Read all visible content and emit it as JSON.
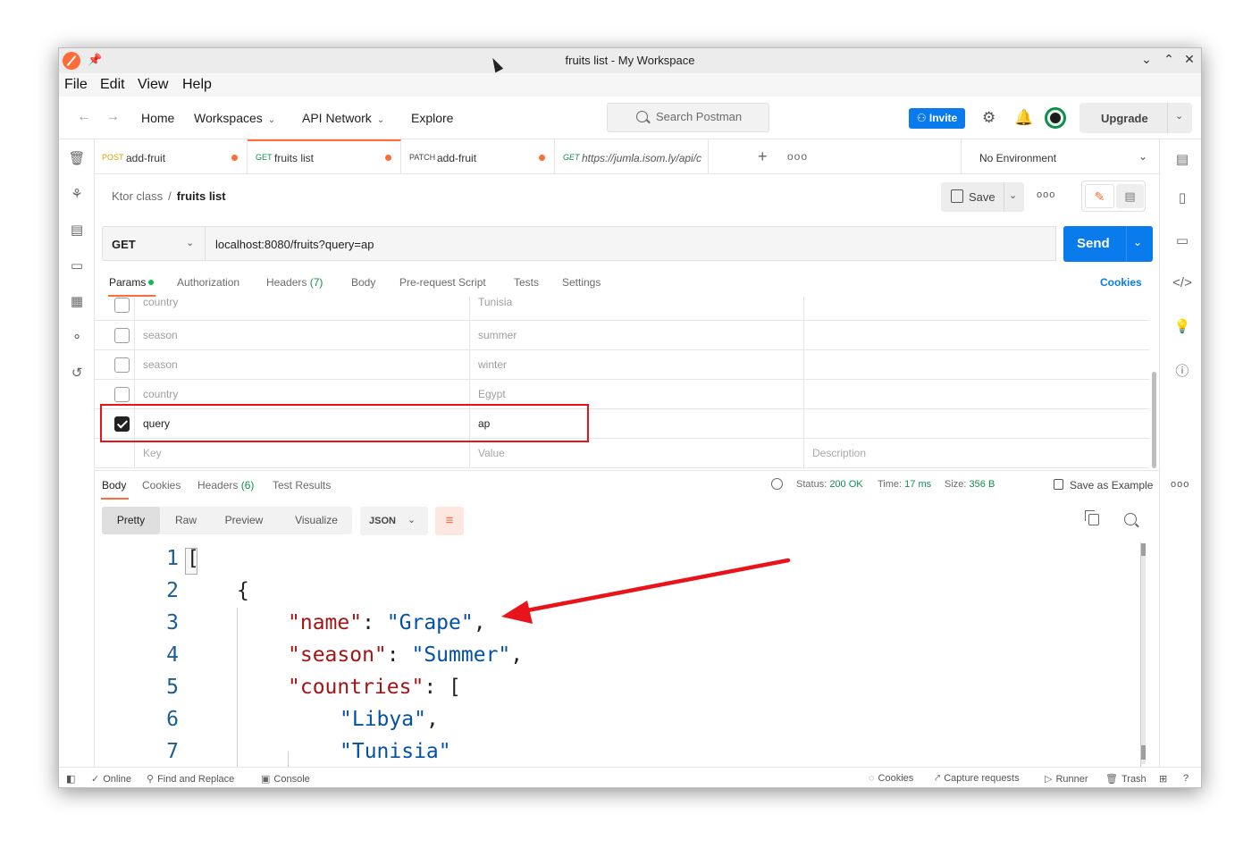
{
  "window": {
    "title": "fruits list - My Workspace"
  },
  "menu": [
    "File",
    "Edit",
    "View",
    "Help"
  ],
  "header": {
    "nav": [
      "Home",
      "Workspaces",
      "API Network",
      "Explore"
    ],
    "search_placeholder": "Search Postman",
    "invite_label": "Invite",
    "upgrade_label": "Upgrade"
  },
  "tabs": [
    {
      "method": "POST",
      "name": "add-fruit",
      "method_color": "#e1a000",
      "unsaved": true
    },
    {
      "method": "GET",
      "name": "fruits list",
      "method_color": "#0f8f4e",
      "unsaved": true,
      "active": true
    },
    {
      "method": "PATCH",
      "name": "add-fruit",
      "method_color": "#6b4fbb",
      "unsaved": true
    },
    {
      "method": "GET",
      "name": "https://jumla.isom.ly/api/c",
      "method_color": "#0f8f4e"
    }
  ],
  "environment": "No Environment",
  "breadcrumb": {
    "collection": "Ktor class",
    "separator": "/",
    "request": "fruits list"
  },
  "save_label": "Save",
  "request": {
    "method": "GET",
    "url": "localhost:8080/fruits?query=ap",
    "send_label": "Send"
  },
  "request_tabs": {
    "params": "Params",
    "authorization": "Authorization",
    "headers": "Headers",
    "headers_count": "(7)",
    "body": "Body",
    "prerequest": "Pre-request Script",
    "tests": "Tests",
    "settings": "Settings",
    "cookies": "Cookies"
  },
  "params": [
    {
      "key": "country",
      "value": "Tunisia",
      "enabled": false
    },
    {
      "key": "season",
      "value": "summer",
      "enabled": false
    },
    {
      "key": "season",
      "value": "winter",
      "enabled": false
    },
    {
      "key": "country",
      "value": "Egypt",
      "enabled": false
    },
    {
      "key": "query",
      "value": "ap",
      "enabled": true
    }
  ],
  "params_placeholder": {
    "key": "Key",
    "value": "Value",
    "description": "Description"
  },
  "response_tabs": {
    "body": "Body",
    "cookies": "Cookies",
    "headers": "Headers",
    "headers_count": "(6)",
    "test_results": "Test Results"
  },
  "response_meta": {
    "status_label": "Status:",
    "status": "200 OK",
    "time_label": "Time:",
    "time": "17 ms",
    "size_label": "Size:",
    "size": "356 B",
    "save_example": "Save as Example"
  },
  "format_buttons": [
    "Pretty",
    "Raw",
    "Preview",
    "Visualize"
  ],
  "format_active": "Pretty",
  "format_select": "JSON",
  "code_lines": [
    {
      "n": "1",
      "text": "["
    },
    {
      "n": "2",
      "text": "{"
    },
    {
      "n": "3",
      "key": "\"name\"",
      "sep": ": ",
      "val": "\"Grape\"",
      "tail": ","
    },
    {
      "n": "4",
      "key": "\"season\"",
      "sep": ": ",
      "val": "\"Summer\"",
      "tail": ","
    },
    {
      "n": "5",
      "key": "\"countries\"",
      "sep": ": ",
      "tail": "["
    },
    {
      "n": "6",
      "val": "\"Libya\"",
      "tail": ","
    },
    {
      "n": "7",
      "val": "\"Tunisia\"",
      "tail": ""
    }
  ],
  "statusbar": {
    "online": "Online",
    "find_replace": "Find and Replace",
    "console": "Console",
    "cookies": "Cookies",
    "capture": "Capture requests",
    "runner": "Runner",
    "trash": "Trash"
  },
  "colors": {
    "accent": "#ff6c37",
    "primary": "#097bed",
    "success": "#0f8f4e",
    "annotation": "#e8141a"
  }
}
